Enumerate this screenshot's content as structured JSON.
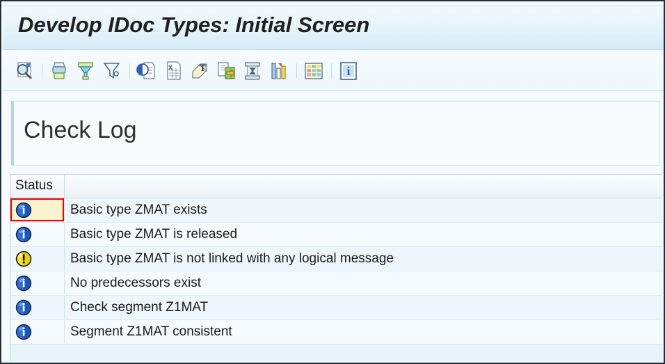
{
  "window": {
    "title": "Develop IDoc Types: Initial Screen"
  },
  "toolbar": {
    "buttons": [
      {
        "name": "display-search-icon",
        "label": "Display/Search"
      },
      {
        "name": "print-icon",
        "label": "Print"
      },
      {
        "name": "sort-filter-icon",
        "label": "Sort"
      },
      {
        "name": "filter-icon",
        "label": "Filter"
      },
      {
        "name": "local-file-icon",
        "label": "Local File"
      },
      {
        "name": "spreadsheet-icon",
        "label": "Spreadsheet"
      },
      {
        "name": "word-processing-icon",
        "label": "Word Processing"
      },
      {
        "name": "send-export-icon",
        "label": "Send"
      },
      {
        "name": "abc-analysis-icon",
        "label": "ABC Analysis"
      },
      {
        "name": "graphic-chart-icon",
        "label": "Graphic"
      },
      {
        "name": "choose-layout-icon",
        "label": "Choose Layout"
      },
      {
        "name": "information-icon",
        "label": "Information"
      }
    ]
  },
  "log_panel": {
    "heading": "Check Log"
  },
  "table": {
    "columns": [
      {
        "key": "status",
        "label": "Status"
      },
      {
        "key": "message",
        "label": ""
      }
    ],
    "rows": [
      {
        "status": "info",
        "message": "Basic type ZMAT exists",
        "selected": true
      },
      {
        "status": "info",
        "message": "Basic type ZMAT is released",
        "selected": false
      },
      {
        "status": "warning",
        "message": "Basic type ZMAT is not linked with any logical message",
        "selected": false
      },
      {
        "status": "info",
        "message": "No predecessors exist",
        "selected": false
      },
      {
        "status": "info",
        "message": "Check segment Z1MAT",
        "selected": false
      },
      {
        "status": "info",
        "message": "Segment Z1MAT consistent",
        "selected": false
      }
    ]
  },
  "colors": {
    "title_bar_top": "#f2f9fd",
    "title_bar_bottom": "#d6ecf8",
    "selection_fill": "#fbf3cd",
    "selection_border": "#ef0000",
    "info_icon": "#2f6fd0",
    "warning_icon": "#f5e03c",
    "window_border": "#22303f"
  }
}
